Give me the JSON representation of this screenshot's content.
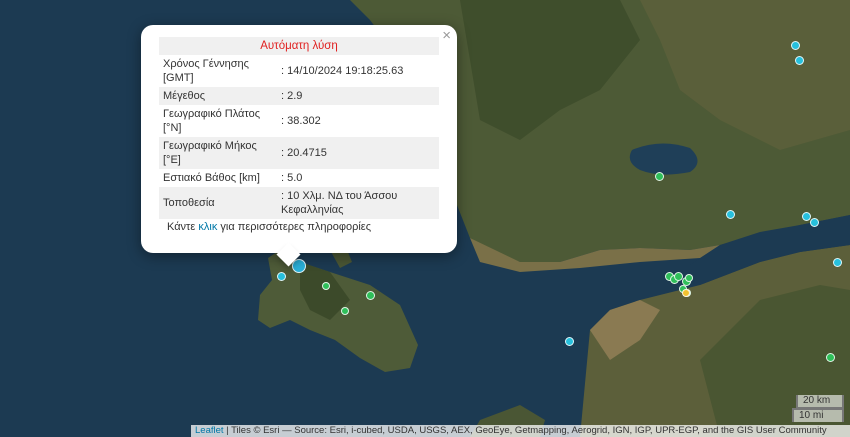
{
  "popup": {
    "title": "Αυτόματη λύση",
    "rows": [
      {
        "label": "Χρόνος Γέννησης [GMT]",
        "value": ": 14/10/2024 19:18:25.63"
      },
      {
        "label": "Μέγεθος",
        "value": ": 2.9"
      },
      {
        "label": "Γεωγραφικό Πλάτος [°N]",
        "value": ": 38.302"
      },
      {
        "label": "Γεωγραφικό Μήκος [°E]",
        "value": ": 20.4715"
      },
      {
        "label": "Εστιακό Βάθος [km]",
        "value": ": 5.0"
      },
      {
        "label": "Τοποθεσία",
        "value": ": 10 Χλμ. ΝΔ του Άσσου Κεφαλληνίας"
      }
    ],
    "more_prefix": "Κάντε",
    "more_link": "κλικ",
    "more_suffix": "για περισσότερες πληροφορίες",
    "close": "×"
  },
  "scale": {
    "km": "20 km",
    "mi": "10 mi"
  },
  "attribution": {
    "leaflet": "Leaflet",
    "text": "| Tiles © Esri — Source: Esri, i-cubed, USDA, USGS, AEX, GeoEye, Getmapping, Aerogrid, IGN, IGP, UPR-EGP, and the GIS User Community"
  },
  "marker_colors": {
    "selected": "#2ab0d8",
    "cyan": "#27c0dd",
    "green": "#2fbf5a",
    "yellow": "#f2c230"
  }
}
